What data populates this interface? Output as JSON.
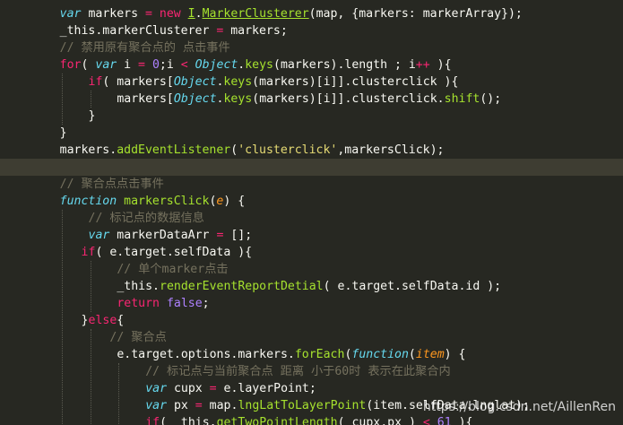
{
  "editor": {
    "theme_colors": {
      "background": "#272822",
      "current_line": "#3e3d32",
      "keyword": "#66d9ef",
      "control": "#f92672",
      "number": "#ae81ff",
      "function": "#a6e22e",
      "string": "#e6db74",
      "comment": "#75715e",
      "parameter": "#fd971f",
      "plain": "#f8f8f2"
    },
    "lines": [
      {
        "indent": 8,
        "tokens": [
          [
            "kw",
            "var"
          ],
          [
            "pl",
            " markers "
          ],
          [
            "ctl",
            "="
          ],
          [
            "pl",
            " "
          ],
          [
            "ctl",
            "new"
          ],
          [
            "pl",
            " "
          ],
          [
            "ul",
            "I"
          ],
          [
            "pl",
            "."
          ],
          [
            "ul",
            "MarkerClusterer"
          ],
          [
            "pl",
            "(map, {markers: markerArray});"
          ]
        ]
      },
      {
        "indent": 8,
        "tokens": [
          [
            "pl",
            "_this.markerClusterer "
          ],
          [
            "ctl",
            "="
          ],
          [
            "pl",
            " markers;"
          ]
        ]
      },
      {
        "indent": 8,
        "tokens": [
          [
            "cm",
            "// 禁用原有聚合点的 点击事件"
          ]
        ]
      },
      {
        "indent": 8,
        "tokens": [
          [
            "ctl",
            "for"
          ],
          [
            "pl",
            "( "
          ],
          [
            "kw",
            "var"
          ],
          [
            "pl",
            " i "
          ],
          [
            "ctl",
            "="
          ],
          [
            "pl",
            " "
          ],
          [
            "num",
            "0"
          ],
          [
            "pl",
            ";i "
          ],
          [
            "ctl",
            "<"
          ],
          [
            "pl",
            " "
          ],
          [
            "cls",
            "Object"
          ],
          [
            "pl",
            "."
          ],
          [
            "fn",
            "keys"
          ],
          [
            "pl",
            "(markers).length ; i"
          ],
          [
            "ctl",
            "++"
          ],
          [
            "pl",
            " ){"
          ]
        ]
      },
      {
        "indent": 12,
        "tokens": [
          [
            "ctl",
            "if"
          ],
          [
            "pl",
            "( markers["
          ],
          [
            "cls",
            "Object"
          ],
          [
            "pl",
            "."
          ],
          [
            "fn",
            "keys"
          ],
          [
            "pl",
            "(markers)[i]].clusterclick ){"
          ]
        ]
      },
      {
        "indent": 16,
        "tokens": [
          [
            "pl",
            "markers["
          ],
          [
            "cls",
            "Object"
          ],
          [
            "pl",
            "."
          ],
          [
            "fn",
            "keys"
          ],
          [
            "pl",
            "(markers)[i]].clusterclick."
          ],
          [
            "fn",
            "shift"
          ],
          [
            "pl",
            "();"
          ]
        ]
      },
      {
        "indent": 12,
        "tokens": [
          [
            "pl",
            "}"
          ]
        ]
      },
      {
        "indent": 8,
        "tokens": [
          [
            "pl",
            "}"
          ]
        ]
      },
      {
        "indent": 8,
        "tokens": [
          [
            "pl",
            "markers."
          ],
          [
            "fn",
            "addEventListener"
          ],
          [
            "pl",
            "("
          ],
          [
            "str",
            "'clusterclick'"
          ],
          [
            "pl",
            ",markersClick);"
          ]
        ]
      },
      {
        "indent": 0,
        "tokens": [],
        "current": true
      },
      {
        "indent": 8,
        "tokens": [
          [
            "cm",
            "// 聚合点点击事件"
          ]
        ]
      },
      {
        "indent": 8,
        "tokens": [
          [
            "kw",
            "function"
          ],
          [
            "pl",
            " "
          ],
          [
            "fn",
            "markersClick"
          ],
          [
            "pl",
            "("
          ],
          [
            "prm",
            "e"
          ],
          [
            "pl",
            ") {"
          ]
        ]
      },
      {
        "indent": 12,
        "tokens": [
          [
            "cm",
            "// 标记点的数据信息"
          ]
        ]
      },
      {
        "indent": 12,
        "tokens": [
          [
            "kw",
            "var"
          ],
          [
            "pl",
            " markerDataArr "
          ],
          [
            "ctl",
            "="
          ],
          [
            "pl",
            " [];"
          ]
        ]
      },
      {
        "indent": 11,
        "tokens": [
          [
            "ctl",
            "if"
          ],
          [
            "pl",
            "( e.target.selfData ){"
          ]
        ]
      },
      {
        "indent": 16,
        "tokens": [
          [
            "cm",
            "// 单个marker点击"
          ]
        ]
      },
      {
        "indent": 16,
        "tokens": [
          [
            "pl",
            "_this."
          ],
          [
            "fn",
            "renderEventReportDetial"
          ],
          [
            "pl",
            "( e.target.selfData.id );"
          ]
        ]
      },
      {
        "indent": 16,
        "tokens": [
          [
            "ctl",
            "return"
          ],
          [
            "pl",
            " "
          ],
          [
            "num",
            "false"
          ],
          [
            "pl",
            ";"
          ]
        ]
      },
      {
        "indent": 11,
        "tokens": [
          [
            "pl",
            "}"
          ],
          [
            "ctl",
            "else"
          ],
          [
            "pl",
            "{"
          ]
        ]
      },
      {
        "indent": 15,
        "tokens": [
          [
            "cm",
            "// 聚合点"
          ]
        ]
      },
      {
        "indent": 16,
        "tokens": [
          [
            "pl",
            "e.target.options.markers."
          ],
          [
            "fn",
            "forEach"
          ],
          [
            "pl",
            "("
          ],
          [
            "kw",
            "function"
          ],
          [
            "pl",
            "("
          ],
          [
            "prm",
            "item"
          ],
          [
            "pl",
            ") {"
          ]
        ]
      },
      {
        "indent": 20,
        "tokens": [
          [
            "cm",
            "// 标记点与当前聚合点 距离 小于60时 表示在此聚合内"
          ]
        ]
      },
      {
        "indent": 20,
        "tokens": [
          [
            "kw",
            "var"
          ],
          [
            "pl",
            " cupx "
          ],
          [
            "ctl",
            "="
          ],
          [
            "pl",
            " e.layerPoint;"
          ]
        ]
      },
      {
        "indent": 20,
        "tokens": [
          [
            "kw",
            "var"
          ],
          [
            "pl",
            " px "
          ],
          [
            "ctl",
            "="
          ],
          [
            "pl",
            " map."
          ],
          [
            "fn",
            "lngLatToLayerPoint"
          ],
          [
            "pl",
            "(item.selfData.lnglat);"
          ]
        ]
      },
      {
        "indent": 20,
        "tokens": [
          [
            "ctl",
            "if"
          ],
          [
            "pl",
            "( _this."
          ],
          [
            "fn",
            "getTwoPointLength"
          ],
          [
            "pl",
            "( cupx,px ) "
          ],
          [
            "ctl",
            "<"
          ],
          [
            "pl",
            " "
          ],
          [
            "num",
            "61"
          ],
          [
            "pl",
            " ){"
          ]
        ]
      }
    ]
  },
  "watermark": {
    "text": "https://blog.csdn.net/AillenRen"
  }
}
